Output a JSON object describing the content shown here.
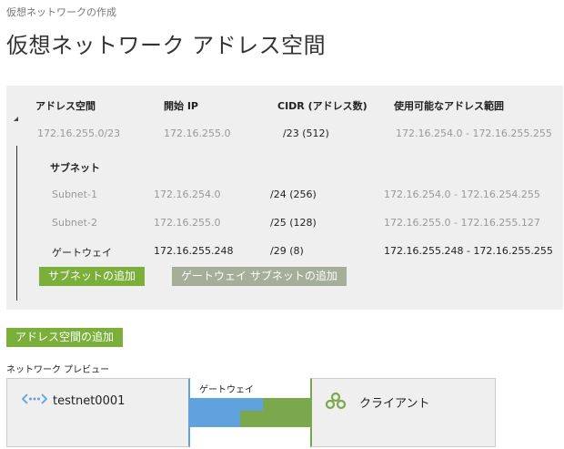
{
  "breadcrumb": "仮想ネットワークの作成",
  "title": "仮想ネットワーク アドレス空間",
  "table": {
    "headers": {
      "address_space": "アドレス空間",
      "start_ip": "開始 IP",
      "cidr": "CIDR (アドレス数)",
      "usable_range": "使用可能なアドレス範囲"
    },
    "address_space_row": {
      "address_space": "172.16.255.0/23",
      "start_ip": "172.16.255.0",
      "cidr": "/23 (512)",
      "usable_range": "172.16.254.0 - 172.16.255.255"
    },
    "subnet_heading": "サブネット",
    "subnets": [
      {
        "name": "Subnet-1",
        "start_ip": "172.16.254.0",
        "cidr": "/24 (256)",
        "usable_range": "172.16.254.0 - 172.16.254.255"
      },
      {
        "name": "Subnet-2",
        "start_ip": "172.16.255.0",
        "cidr": "/25 (128)",
        "usable_range": "172.16.255.0 - 172.16.255.127"
      },
      {
        "name": "ゲートウェイ",
        "start_ip": "172.16.255.248",
        "cidr": "/29 (8)",
        "usable_range": "172.16.255.248 - 172.16.255.255"
      }
    ]
  },
  "buttons": {
    "add_subnet": "サブネットの追加",
    "add_gateway_subnet": "ゲートウェイ サブネットの追加",
    "add_address_space": "アドレス空間の追加"
  },
  "preview": {
    "label": "ネットワーク プレビュー",
    "vnet_name": "testnet0001",
    "gateway_label": "ゲートウェイ",
    "client_label": "クライアント"
  },
  "colors": {
    "accent_green": "#7ab03a",
    "disabled_button": "#a4ae98",
    "vnet_blue": "#5fa2dd",
    "gateway_green": "#7ca84d"
  },
  "icons": {
    "vnet": "vnet-icon",
    "client": "client-icon",
    "collapse": "collapse-caret-icon"
  }
}
